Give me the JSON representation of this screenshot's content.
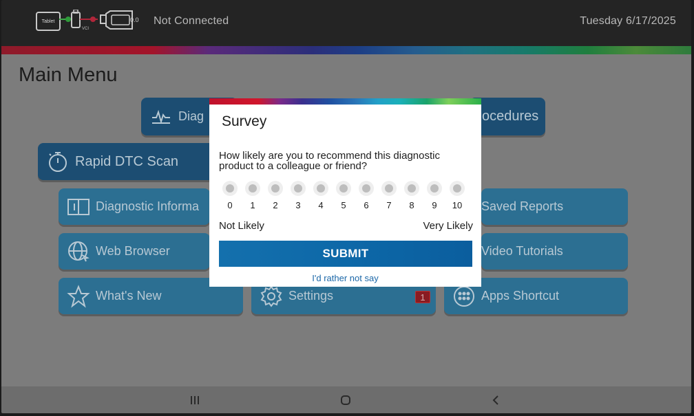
{
  "status_bar": {
    "tablet_label": "Tablet",
    "vci_label": "VCI",
    "voltage": "0.0",
    "connection_status": "Not Connected",
    "date": "Tuesday 6/17/2025"
  },
  "main_menu": {
    "title": "Main Menu",
    "tiles": [
      {
        "id": "diagnostics",
        "label": "Diag",
        "icon": "waveform-icon"
      },
      {
        "id": "procedures",
        "label": "ocedures",
        "icon": "none"
      },
      {
        "id": "rapid-dtc-scan",
        "label": "Rapid DTC Scan",
        "icon": "stopwatch-icon"
      },
      {
        "id": "diagnostic-information",
        "label": "Diagnostic Informa",
        "icon": "book-icon"
      },
      {
        "id": "saved-reports",
        "label": "Saved Reports",
        "icon": "none"
      },
      {
        "id": "web-browser",
        "label": "Web Browser",
        "icon": "globe-cursor-icon"
      },
      {
        "id": "video-tutorials",
        "label": "Video Tutorials",
        "icon": "none"
      },
      {
        "id": "whats-new",
        "label": "What's New",
        "icon": "star-icon"
      },
      {
        "id": "settings",
        "label": "Settings",
        "icon": "gear-icon",
        "badge": "1"
      },
      {
        "id": "apps-shortcut",
        "label": "Apps Shortcut",
        "icon": "grid-dots-icon"
      }
    ]
  },
  "survey": {
    "title": "Survey",
    "question": "How likely are you to recommend this diagnostic product to a colleague or friend?",
    "options": [
      "0",
      "1",
      "2",
      "3",
      "4",
      "5",
      "6",
      "7",
      "8",
      "9",
      "10"
    ],
    "low_label": "Not Likely",
    "high_label": "Very Likely",
    "submit_label": "SUBMIT",
    "skip_label": "I'd rather not say"
  },
  "nav": {
    "recents_icon": "recents-icon",
    "home_icon": "home-icon",
    "back_icon": "back-icon"
  },
  "colors": {
    "tile_dark": "#1c4d72",
    "tile_light": "#2c6f92",
    "submit_blue": "#0d68a8",
    "link_blue": "#1b67a8",
    "badge_red": "#8a1b22"
  }
}
